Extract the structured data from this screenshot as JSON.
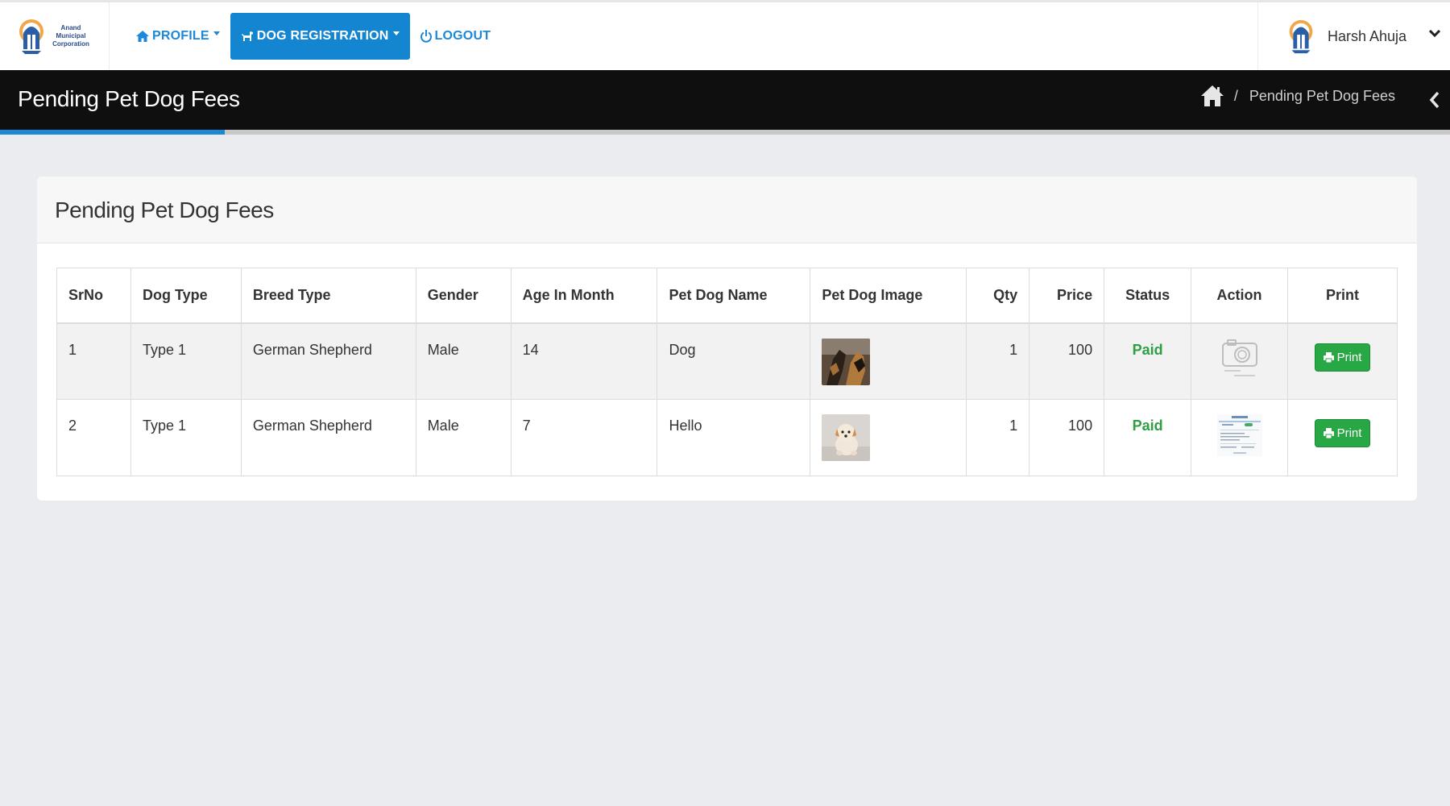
{
  "navbar": {
    "logo_text": "Anand Municipal Corporation",
    "items": [
      {
        "label": "PROFILE",
        "icon": "home-icon"
      },
      {
        "label": "DOG REGISTRATION",
        "icon": "dog-icon"
      },
      {
        "label": "LOGOUT",
        "icon": "power-icon"
      }
    ],
    "user": {
      "name": "Harsh Ahuja"
    }
  },
  "titlebar": {
    "title": "Pending Pet Dog Fees",
    "breadcrumb": {
      "separator": "/",
      "current": "Pending Pet Dog Fees"
    }
  },
  "card": {
    "title": "Pending Pet Dog Fees",
    "table": {
      "headers": [
        "SrNo",
        "Dog Type",
        "Breed Type",
        "Gender",
        "Age In Month",
        "Pet Dog Name",
        "Pet Dog Image",
        "Qty",
        "Price",
        "Status",
        "Action",
        "Print"
      ],
      "rows": [
        {
          "srno": "1",
          "dog_type": "Type 1",
          "breed": "German Shepherd",
          "gender": "Male",
          "age": "14",
          "name": "Dog",
          "image": "german-shepherd-photo",
          "qty": "1",
          "price": "100",
          "status": "Paid",
          "action": "no-image-available",
          "print_label": "Print"
        },
        {
          "srno": "2",
          "dog_type": "Type 1",
          "breed": "German Shepherd",
          "gender": "Male",
          "age": "7",
          "name": "Hello",
          "image": "puppy-photo",
          "qty": "1",
          "price": "100",
          "status": "Paid",
          "action": "document-thumbnail",
          "print_label": "Print"
        }
      ]
    }
  },
  "colors": {
    "accent": "#1485d0",
    "titlebar": "#0f0f0f",
    "paid": "#2e9e44",
    "print_button": "#28a745"
  }
}
